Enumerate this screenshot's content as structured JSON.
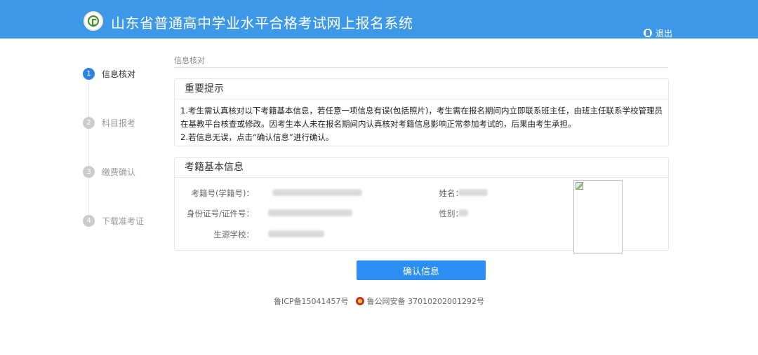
{
  "header": {
    "title": "山东省普通高中学业水平合格考试网上报名系统",
    "logout_label": "退出",
    "logo_icon": "school-emblem-icon",
    "user_icon": "user-icon"
  },
  "steps": [
    {
      "num": "1",
      "label": "信息核对",
      "active": true
    },
    {
      "num": "2",
      "label": "科目报考",
      "active": false
    },
    {
      "num": "3",
      "label": "缴费确认",
      "active": false
    },
    {
      "num": "4",
      "label": "下载准考证",
      "active": false
    }
  ],
  "breadcrumb": "信息核对",
  "notice": {
    "title": "重要提示",
    "line1": "1.考生需认真核对以下考籍基本信息，若任意一项信息有误(包括照片)，考生需在报名期间内立即联系班主任，由班主任联系学校管理员在基教平台核查或修改。因考生本人未在报名期间内认真核对考籍信息影响正常参加考试的，后果由考生承担。",
    "line2": "2.若信息无误，点击“确认信息”进行确认。"
  },
  "info": {
    "title": "考籍基本信息",
    "labels": {
      "student_no": "考籍号(学籍号)：",
      "id_no": "身份证号/证件号：",
      "school": "生源学校：",
      "name": "姓名：",
      "gender": "性别："
    }
  },
  "confirm_button": "确认信息",
  "footer": {
    "icp": "鲁ICP备15041457号",
    "police": "鲁公网安备 37010202001292号",
    "police_icon": "police-badge-icon"
  },
  "colors": {
    "header_bg": "#3e98e8",
    "accent": "#2b8ef3",
    "active_step": "#2b83e3"
  }
}
